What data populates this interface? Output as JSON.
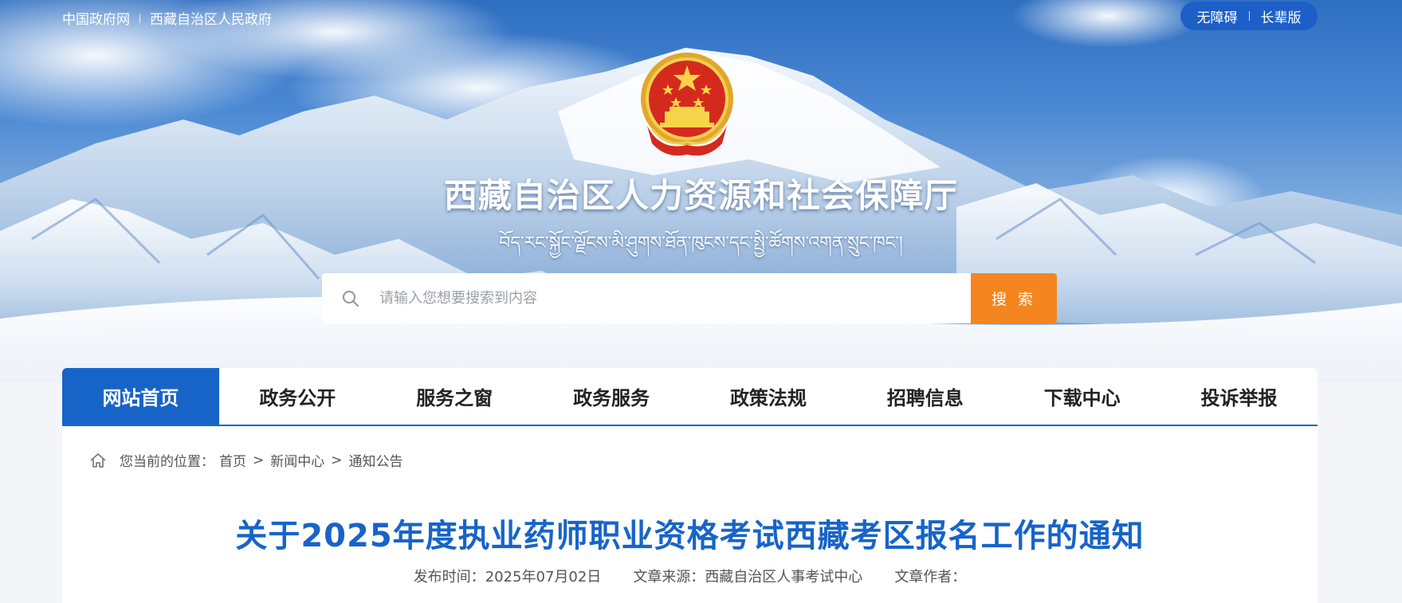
{
  "topbar": {
    "links": [
      "中国政府网",
      "西藏自治区人民政府"
    ],
    "accessibility": "无障碍",
    "elder": "长辈版"
  },
  "site": {
    "title": "西藏自治区人力资源和社会保障厅",
    "subtitle_tibetan": "བོད་རང་སྐྱོང་ལྗོངས་མི་ཤུགས་ཐོན་ཁུངས་དང་སྤྱི་ཚོགས་འགན་སྲུང་ཁང་།"
  },
  "search": {
    "placeholder": "请输入您想要搜索到内容",
    "button": "搜 索"
  },
  "nav": {
    "items": [
      "网站首页",
      "政务公开",
      "服务之窗",
      "政务服务",
      "政策法规",
      "招聘信息",
      "下载中心",
      "投诉举报"
    ]
  },
  "breadcrumb": {
    "prefix": "您当前的位置：",
    "items": [
      "首页",
      "新闻中心",
      "通知公告"
    ],
    "separator": ">"
  },
  "article": {
    "title": "关于2025年度执业药师职业资格考试西藏考区报名工作的通知",
    "publish_label": "发布时间：",
    "publish_date": "2025年07月02日",
    "source_label": "文章来源：",
    "source": "西藏自治区人事考试中心",
    "author_label": "文章作者：",
    "author": ""
  },
  "colors": {
    "primary": "#1764c8",
    "search_button": "#f5861f",
    "accessibility_pill": "#1d5fc6"
  },
  "icons": [
    "search-icon",
    "home-icon",
    "national-emblem"
  ]
}
